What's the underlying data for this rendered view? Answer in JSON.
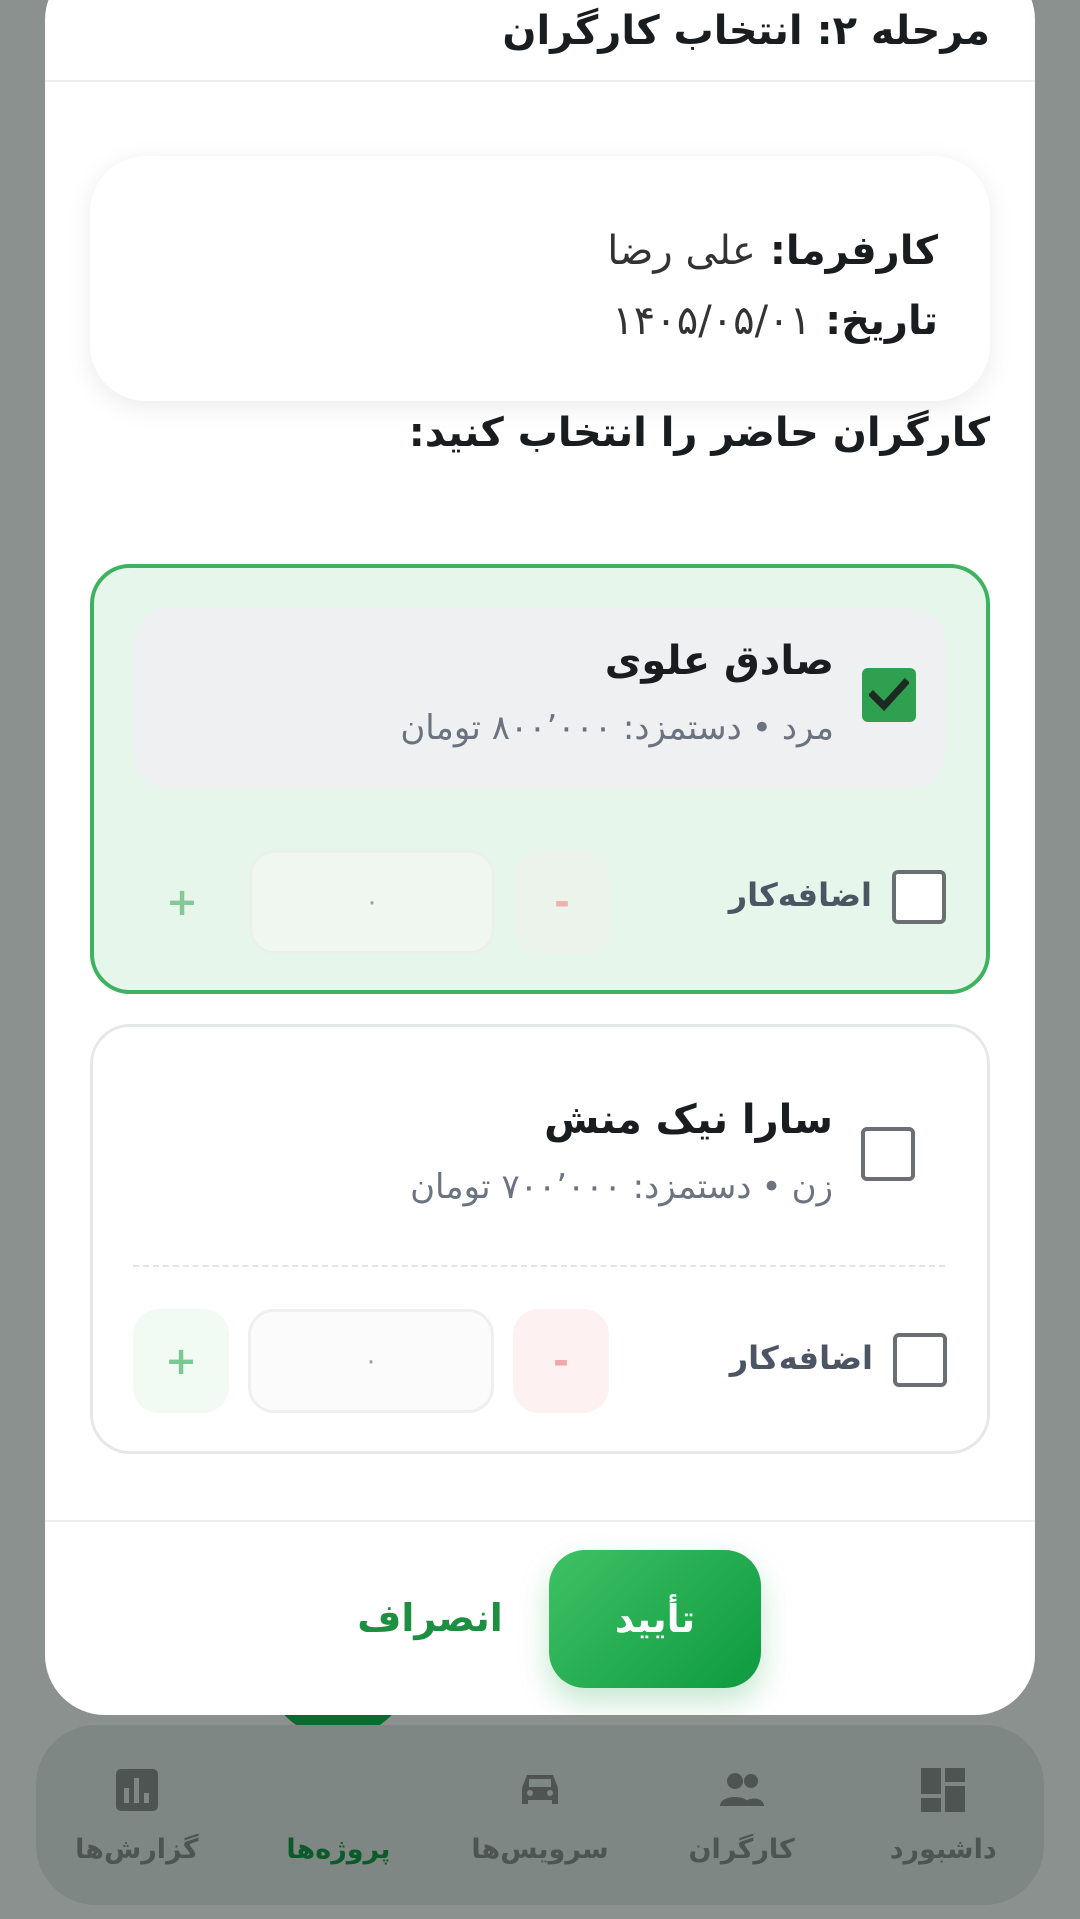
{
  "modal": {
    "title": "مرحله ۲: انتخاب کارگران",
    "client_label": "کارفرما:",
    "client_name": "علی رضا",
    "date_label": "تاریخ:",
    "date_value": "۱۴۰۵/۰۵/۰۱",
    "section_title": "کارگران حاضر را انتخاب کنید:"
  },
  "workers": [
    {
      "name": "صادق علوی",
      "gender": "مرد",
      "separator": "•",
      "wage": "دستمزد: ۸۰۰٬۰۰۰ تومان",
      "selected": true,
      "overtime_label": "اضافه‌کار",
      "overtime_checked": false,
      "overtime_value": "۰",
      "minus": "-",
      "plus": "+"
    },
    {
      "name": "سارا نیک منش",
      "gender": "زن",
      "separator": "•",
      "wage": "دستمزد: ۷۰۰٬۰۰۰ تومان",
      "selected": false,
      "overtime_label": "اضافه‌کار",
      "overtime_checked": false,
      "overtime_value": "۰",
      "minus": "-",
      "plus": "+"
    }
  ],
  "actions": {
    "confirm": "تأیید",
    "cancel": "انصراف"
  },
  "nav": {
    "items": [
      {
        "label": "داشبورد",
        "icon": "dashboard-icon"
      },
      {
        "label": "کارگران",
        "icon": "people-icon"
      },
      {
        "label": "سرویس‌ها",
        "icon": "car-icon"
      },
      {
        "label": "پروژه‌ها",
        "icon": "document-icon",
        "active": true
      },
      {
        "label": "گزارش‌ها",
        "icon": "bar-chart-icon"
      }
    ]
  },
  "colors": {
    "accent": "#2fa04f",
    "selected_card_bg": "#e7f6ea",
    "cancel_text": "#1c8f40"
  }
}
